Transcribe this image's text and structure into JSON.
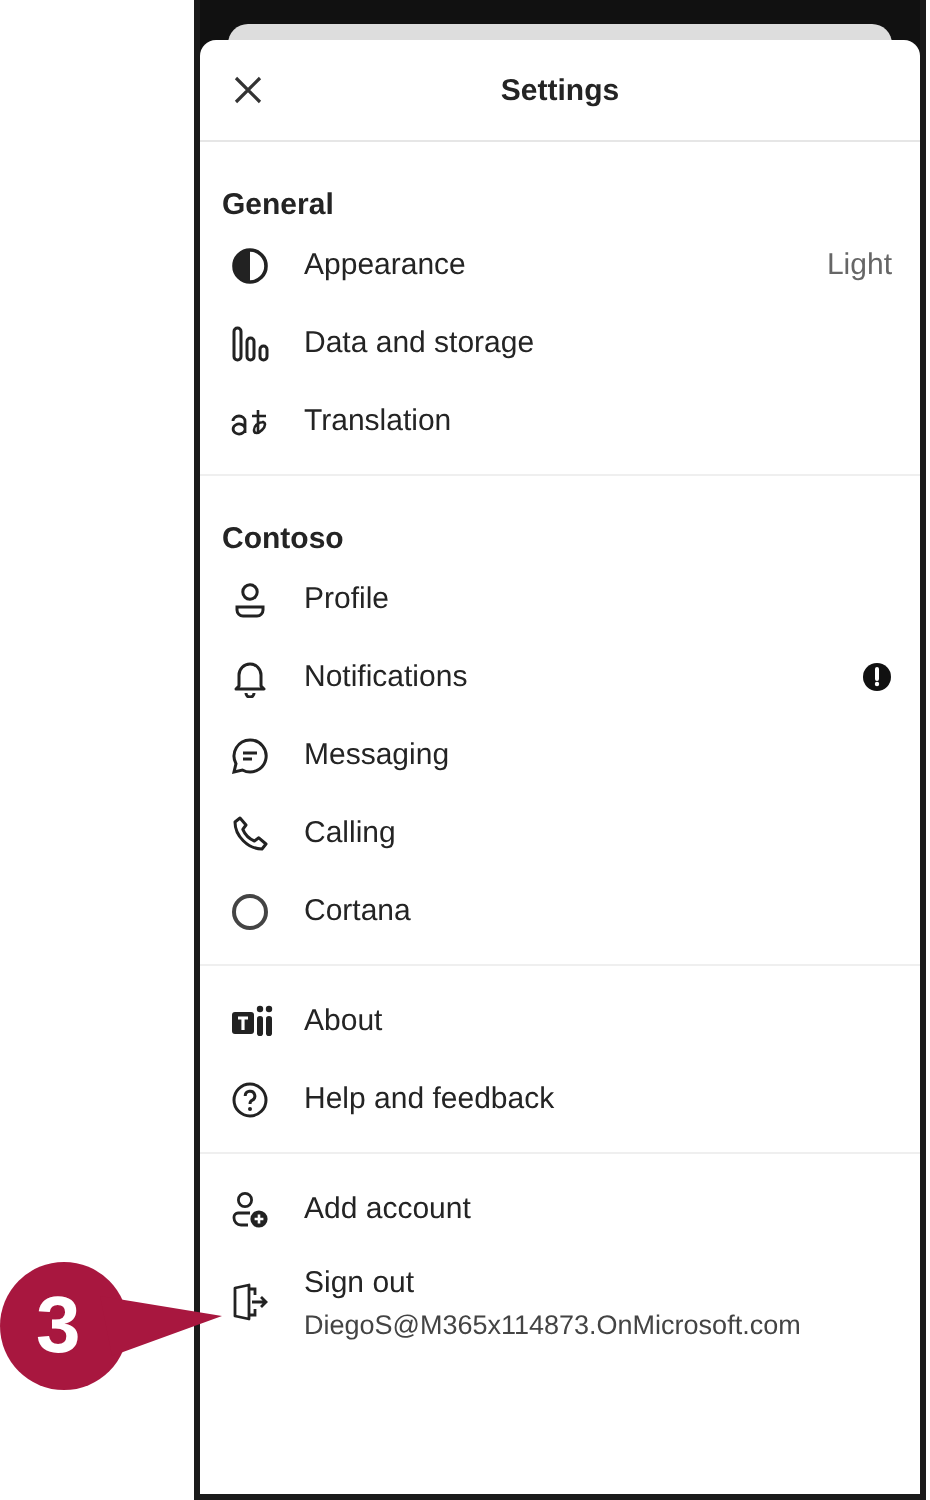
{
  "header": {
    "title": "Settings"
  },
  "sections": [
    {
      "heading": "General",
      "items": [
        {
          "label": "Appearance",
          "value": "Light"
        },
        {
          "label": "Data and storage"
        },
        {
          "label": "Translation"
        }
      ]
    },
    {
      "heading": "Contoso",
      "items": [
        {
          "label": "Profile"
        },
        {
          "label": "Notifications",
          "alert": true
        },
        {
          "label": "Messaging"
        },
        {
          "label": "Calling"
        },
        {
          "label": "Cortana"
        }
      ]
    },
    {
      "items": [
        {
          "label": "About"
        },
        {
          "label": "Help and feedback"
        }
      ]
    },
    {
      "items": [
        {
          "label": "Add account"
        },
        {
          "label": "Sign out",
          "subtitle": "DiegoS@M365x114873.OnMicrosoft.com"
        }
      ]
    }
  ],
  "callout": {
    "label": "3"
  }
}
